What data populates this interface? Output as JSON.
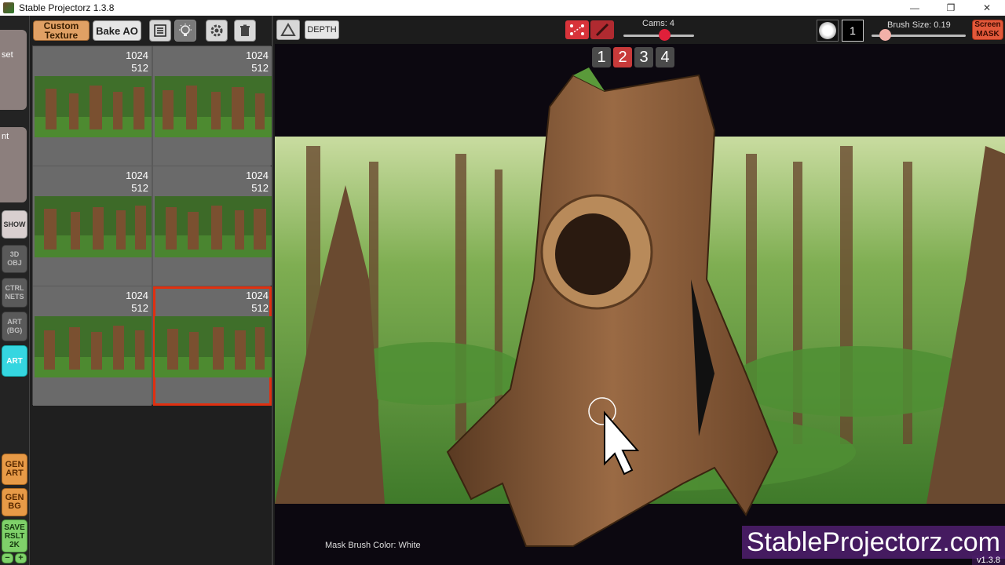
{
  "window": {
    "title": "Stable Projectorz 1.3.8",
    "controls": [
      "—",
      "❐",
      "✕"
    ]
  },
  "left_strip": {
    "card_top_label": "set",
    "card_mid_label": "nt",
    "modes": {
      "show": "SHOW",
      "obj3d": "3D OBJ",
      "ctrlnets": "CTRL NETS",
      "artbg": "ART (BG)",
      "art": "ART"
    },
    "actions": {
      "gen_art": "GEN ART",
      "gen_bg": "GEN BG",
      "save": "SAVE RSLT 2K",
      "minus": "−",
      "plus": "+"
    }
  },
  "texture_panel": {
    "custom_texture_label": "Custom Texture",
    "bake_ao_label": "Bake AO",
    "icons": [
      "list-icon",
      "lightbulb-icon",
      "gear-icon",
      "trash-icon"
    ],
    "cells": [
      {
        "width": "1024",
        "height": "512",
        "selected": false
      },
      {
        "width": "1024",
        "height": "512",
        "selected": false
      },
      {
        "width": "1024",
        "height": "512",
        "selected": false
      },
      {
        "width": "1024",
        "height": "512",
        "selected": false
      },
      {
        "width": "1024",
        "height": "512",
        "selected": false
      },
      {
        "width": "1024",
        "height": "512",
        "selected": true
      }
    ]
  },
  "topbar": {
    "depth_label": "DEPTH",
    "cams_label": "Cams: 4",
    "cams_value": 4,
    "brush_count": "1",
    "brush_size_label": "Brush Size: 0.19",
    "brush_size_value": 0.19,
    "screen_mask_label": "Screen MASK",
    "accent_red": "#d8333a"
  },
  "viewport": {
    "cam_numbers": [
      "1",
      "2",
      "3",
      "4"
    ],
    "active_cam": "2",
    "watermark_line1": "StableProjectorz.com",
    "watermark_line2": "v1.3.8",
    "mask_brush_color": "Mask Brush Color: White"
  }
}
